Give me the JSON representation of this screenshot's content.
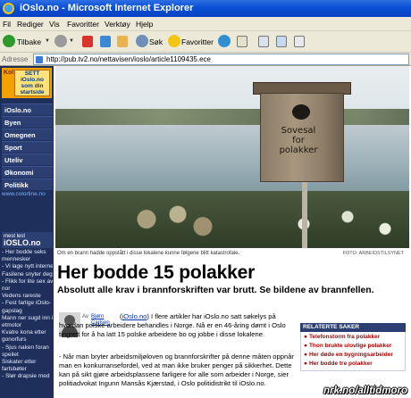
{
  "window": {
    "title": "iOslo.no - Microsoft Internet Explorer"
  },
  "menu": [
    "Fil",
    "Rediger",
    "Vis",
    "Favoritter",
    "Verktøy",
    "Hjelp"
  ],
  "toolbar": {
    "back_label": "Tilbake",
    "search_label": "Søk",
    "favorites_label": "Favoritter"
  },
  "address": {
    "label": "Adresse",
    "url": "http://pub.tv2.no/nettavisen/ioslo/article1109435.ece"
  },
  "sidebar": {
    "ad_left": "Kol",
    "ad_lines": [
      "SETT",
      "iOslo.no",
      "som din",
      "startside"
    ],
    "nav": [
      "iOslo.no",
      "Byen",
      "Omegnen",
      "Sport",
      "Uteliv",
      "Økonomi",
      "Politikk"
    ],
    "colorline": "www.colorline.no",
    "mest_lest_top": "mest lest",
    "mest_lest_site": "iOSLO.no",
    "mest_lest_items": [
      "- Her bodde seks",
      "mennesker",
      "- Vi lage nytt internett",
      "Fasilene snyter deg",
      "- Flikk for lite sex av",
      "nor",
      "Vedens rareste",
      "- Fest farlige iOslo-",
      "gapslag",
      "Mann ner sugd inn i",
      "etmotor",
      "Kvatre kona etter",
      "gonorfurs",
      "- Sjus naken foran",
      "speilet",
      "Siskater etter",
      "fartsbøter",
      "- Slør drapsie med"
    ]
  },
  "photo": {
    "sign_text": [
      "Sovesal",
      "for",
      "polakker"
    ],
    "caption": "Om en brann hadde oppstått i disse lokalene kunne følgene blitt katastrofale.",
    "credit": "FOTO: ARBEIDSTILSYNET"
  },
  "article": {
    "headline": "Her bodde 15 polakker",
    "lead": "Absolutt alle krav i brannforskriften var brutt. Se bildene av brannfellen.",
    "author_prefix": "Av",
    "author_name": "Bjørn Carlsen",
    "body1_link": "iOslo.no",
    "body1_rest": ") I flere artikler har iOslo.no satt søkelys på hvordan polske arbeidere behandles i Norge. Nå er en 46-åring dømt i Oslo tingrett for å ha latt 15 polske arbeidere bo og jobbe i disse lokalene.",
    "body2": "- Når man bryter arbeidsmiljøloven og brannforskrifter på denne måten oppnår man en konkurransefordel, ved at man ikke bruker penger på sikkerhet. Dette kan på sikt gjøre arbeidsplassene farligere for alle som arbeider i Norge, sier politiadvokat Ingunn Mansås Kjærstad, i Oslo politidistrikt til iOslo.no."
  },
  "related": {
    "title": "RELATERTE SAKER",
    "items": [
      "Telefonstorm fra polakker",
      "Thon brukte ulovlige polakker",
      "Her døde en bygningsarbeider",
      "Her bodde tre polakker"
    ]
  },
  "watermark": "nrk.no/alltidmoro"
}
